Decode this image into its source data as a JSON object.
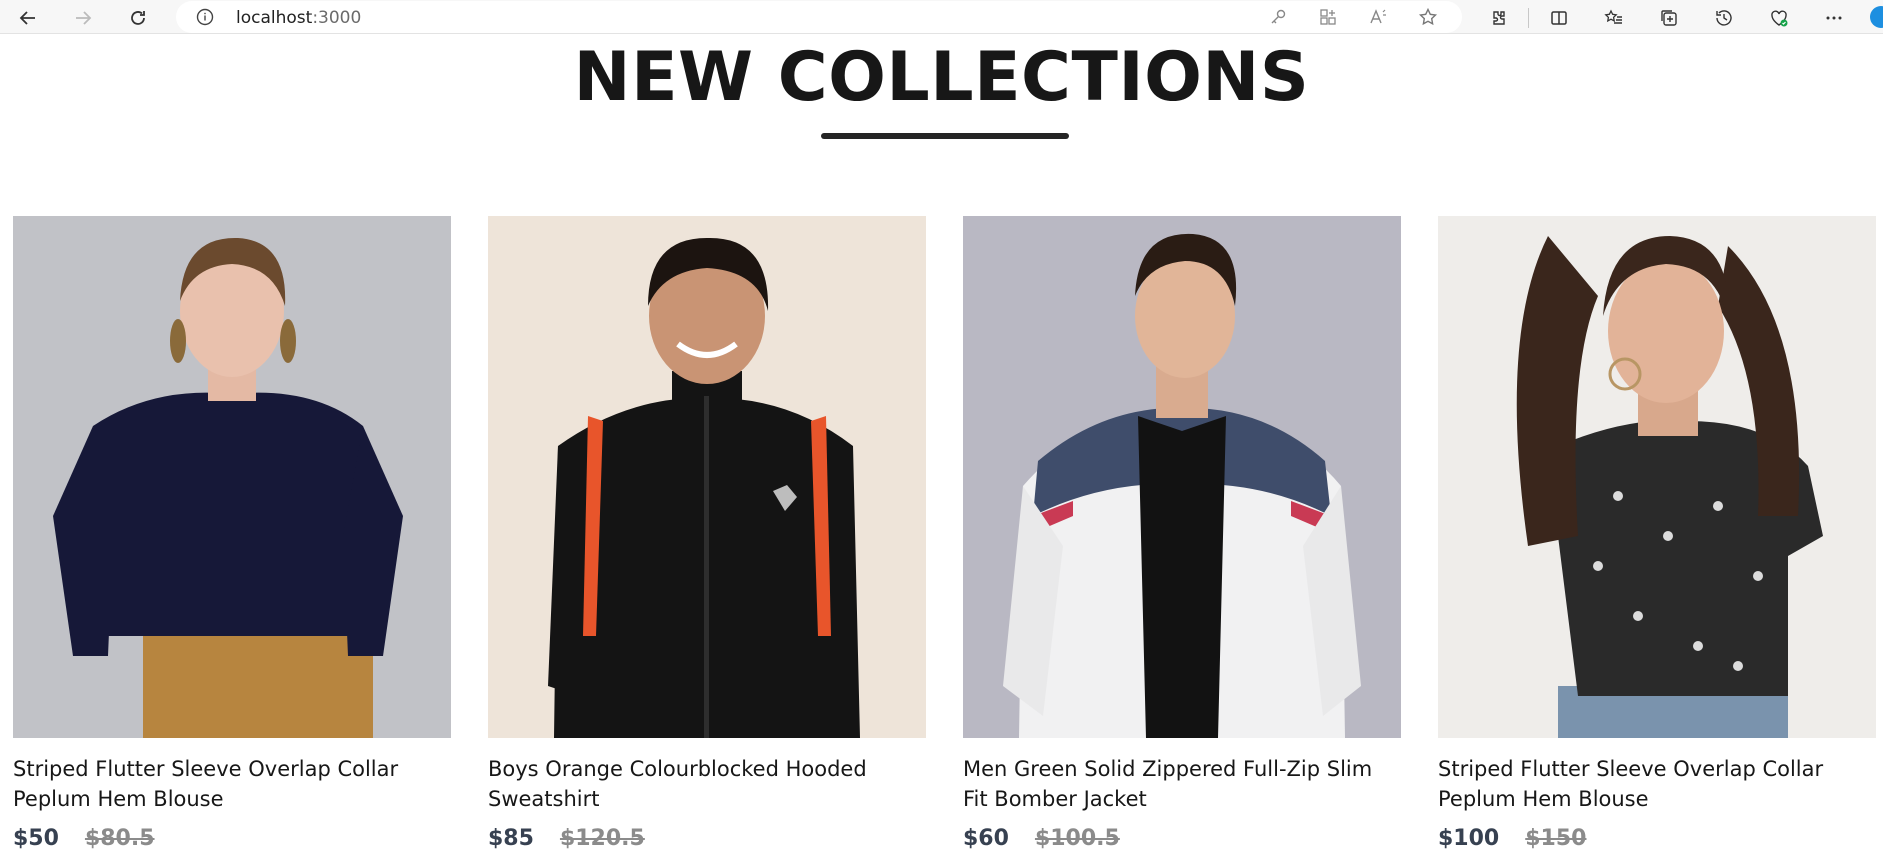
{
  "browser": {
    "url_host": "localhost",
    "url_port": ":3000"
  },
  "section": {
    "title": "NEW COLLECTIONS"
  },
  "products": [
    {
      "name": "Striped Flutter Sleeve Overlap Collar Peplum Hem Blouse",
      "new_price": "$50",
      "old_price": "$80.5"
    },
    {
      "name": "Boys Orange Colourblocked Hooded Sweatshirt",
      "new_price": "$85",
      "old_price": "$120.5"
    },
    {
      "name": "Men Green Solid Zippered Full-Zip Slim Fit Bomber Jacket",
      "new_price": "$60",
      "old_price": "$100.5"
    },
    {
      "name": "Striped Flutter Sleeve Overlap Collar Peplum Hem Blouse",
      "new_price": "$100",
      "old_price": "$150"
    }
  ],
  "colors": {
    "title": "#171717",
    "price_new": "#374151",
    "price_old": "#8b8b8b"
  }
}
